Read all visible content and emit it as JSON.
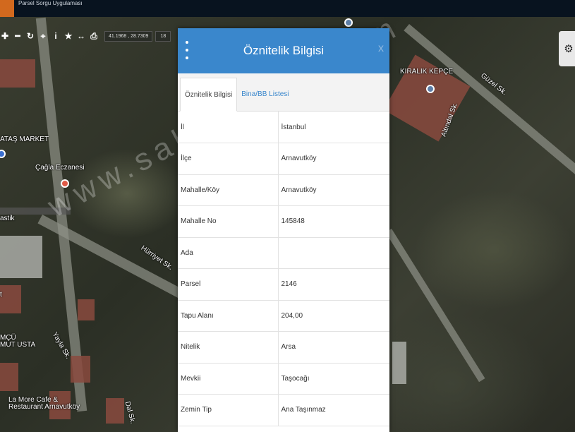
{
  "app": {
    "title": "Parsel Sorgu Uygulaması"
  },
  "toolbar": {
    "buttons": [
      {
        "name": "move-icon",
        "glyph": "✚"
      },
      {
        "name": "zoom-out-icon",
        "glyph": "━"
      },
      {
        "name": "refresh-icon",
        "glyph": "↻"
      },
      {
        "name": "locate-icon",
        "glyph": "⌖"
      },
      {
        "name": "info-icon",
        "glyph": "i"
      },
      {
        "name": "star-icon",
        "glyph": "★"
      },
      {
        "name": "measure-icon",
        "glyph": "↔"
      },
      {
        "name": "print-icon",
        "glyph": "⎙"
      }
    ],
    "coordinates": "41.1968 , 28.7309",
    "zoom": "18"
  },
  "map": {
    "labels": {
      "market": "ATAŞ MARKET",
      "pharmacy": "Çağla Eczanesi",
      "plastik": "astik",
      "hurriyet": "Hürriyet Sk.",
      "kiralik": "KIRALIK KEPÇE",
      "altindal": "Altındal Sk.",
      "guzel": "Güzel Sk.",
      "yayla": "Yayla Sk.",
      "mutusta": "MÇÜ\nMUT USTA",
      "lamore": "La More Cafe &\nRestaurant Arnavutköy",
      "dalisk": "Dal Sk.",
      "t": "t"
    },
    "watermark": "www.sahibinden.com"
  },
  "panel": {
    "title": "Öznitelik Bilgisi",
    "close": "x",
    "tabs": [
      {
        "label": "Öznitelik Bilgisi",
        "active": true
      },
      {
        "label": "Bina/BB Listesi",
        "active": false
      }
    ],
    "rows": [
      {
        "key": "İl",
        "value": "İstanbul"
      },
      {
        "key": "İlçe",
        "value": "Arnavutköy"
      },
      {
        "key": "Mahalle/Köy",
        "value": "Arnavutköy"
      },
      {
        "key": "Mahalle No",
        "value": "145848"
      },
      {
        "key": "Ada",
        "value": ""
      },
      {
        "key": "Parsel",
        "value": "2146"
      },
      {
        "key": "Tapu Alanı",
        "value": "204,00"
      },
      {
        "key": "Nitelik",
        "value": "Arsa"
      },
      {
        "key": "Mevkii",
        "value": "Taşocağı"
      },
      {
        "key": "Zemin Tip",
        "value": "Ana Taşınmaz"
      }
    ]
  }
}
